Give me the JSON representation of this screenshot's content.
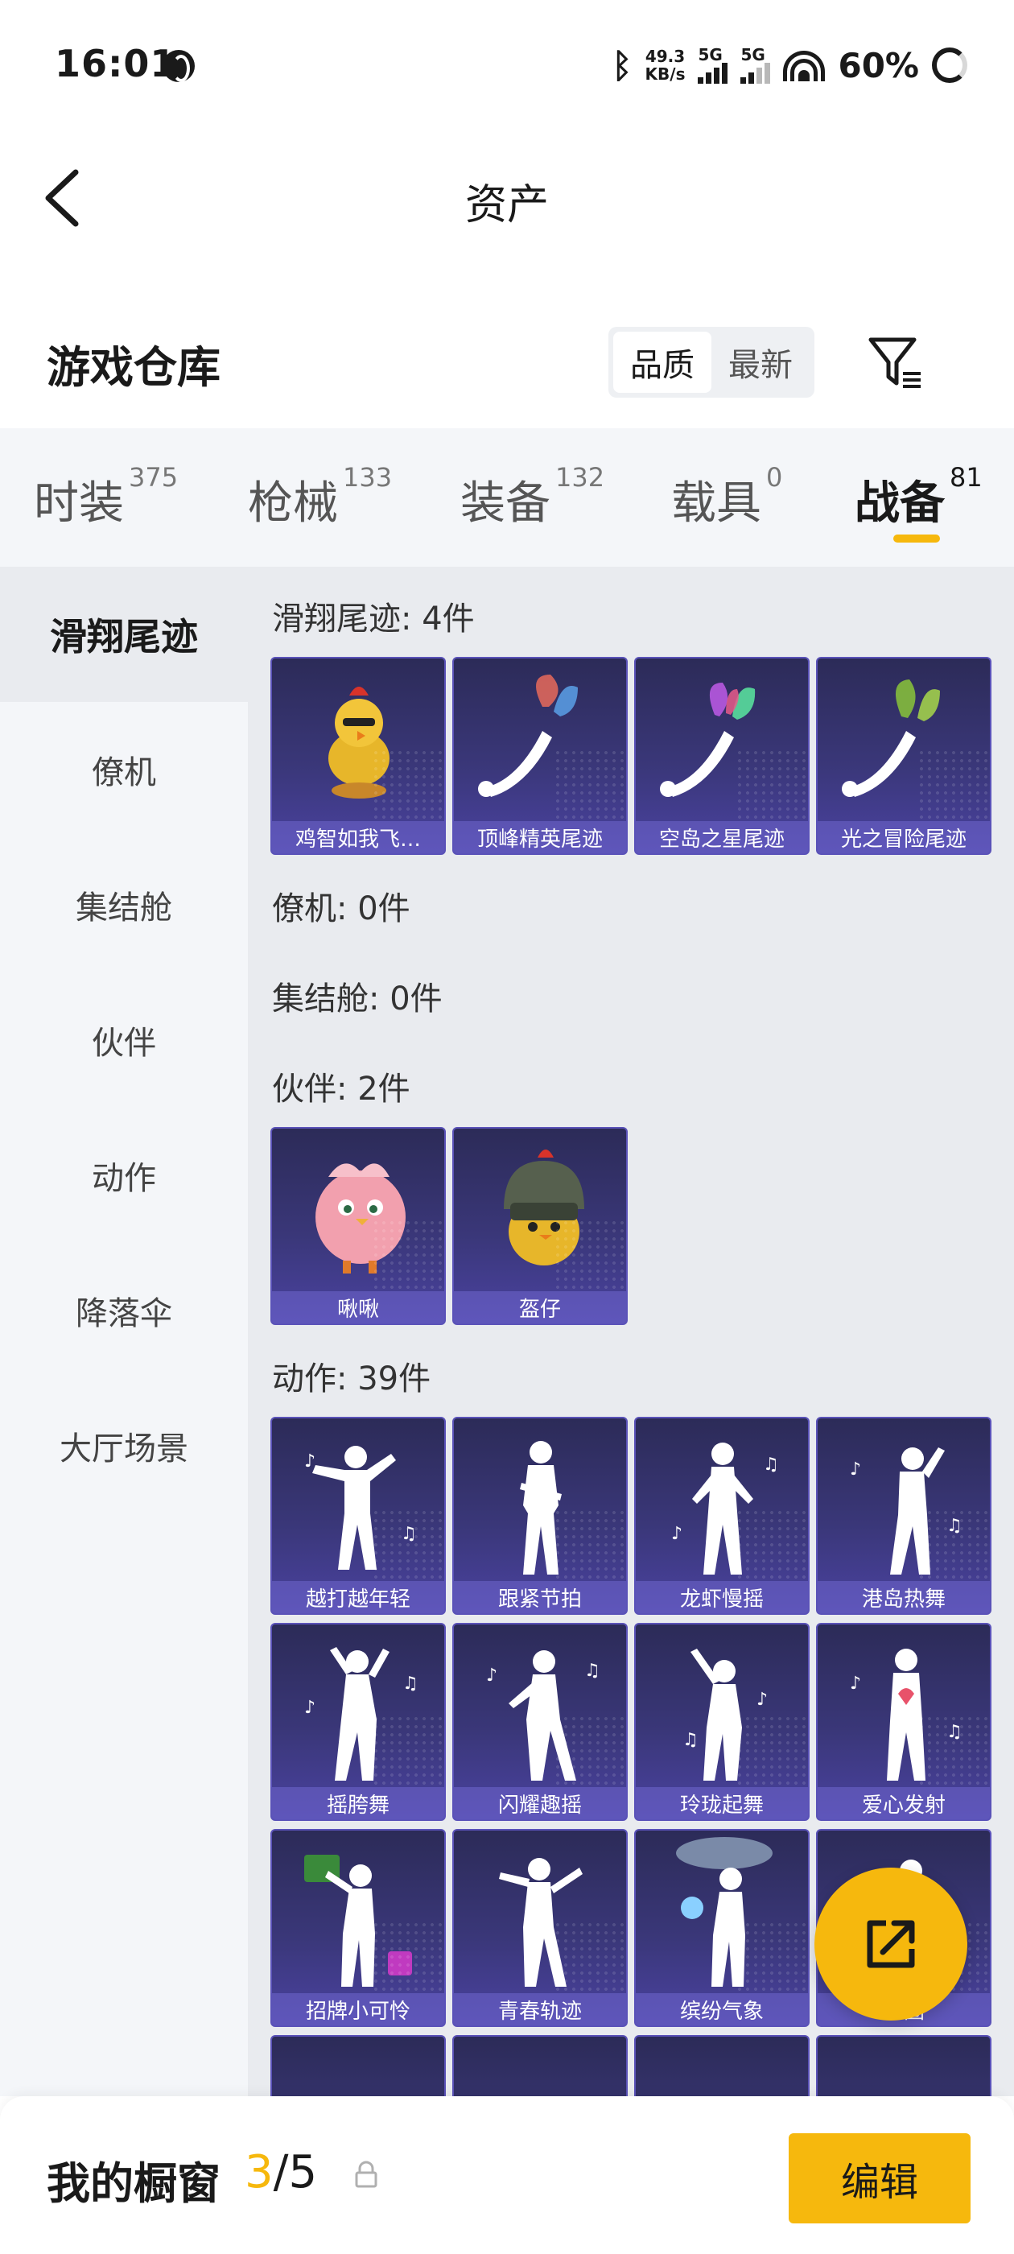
{
  "status_bar": {
    "time": "16:01",
    "net_speed_value": "49.3",
    "net_speed_unit": "KB/s",
    "sim1_label": "5G",
    "sim2_label": "5G",
    "battery": "60%"
  },
  "header": {
    "title": "资产"
  },
  "warehouse": {
    "title": "游戏仓库",
    "sort_options": [
      "品质",
      "最新"
    ],
    "active_sort": "品质"
  },
  "tabs": [
    {
      "label": "时装",
      "count": "375"
    },
    {
      "label": "枪械",
      "count": "133"
    },
    {
      "label": "装备",
      "count": "132"
    },
    {
      "label": "载具",
      "count": "0"
    },
    {
      "label": "战备",
      "count": "81"
    }
  ],
  "active_tab": "战备",
  "sidebar": {
    "items": [
      "滑翔尾迹",
      "僚机",
      "集结舱",
      "伙伴",
      "动作",
      "降落伞",
      "大厅场景"
    ],
    "active": "滑翔尾迹"
  },
  "sections": [
    {
      "title": "滑翔尾迹: 4件",
      "items": [
        "鸡智如我飞…",
        "顶峰精英尾迹",
        "空岛之星尾迹",
        "光之冒险尾迹"
      ]
    },
    {
      "title": "僚机: 0件",
      "items": []
    },
    {
      "title": "集结舱: 0件",
      "items": []
    },
    {
      "title": "伙伴: 2件",
      "items": [
        "啾啾",
        "盔仔"
      ]
    },
    {
      "title": "动作: 39件",
      "items": [
        "越打越年轻",
        "跟紧节拍",
        "龙虾慢摇",
        "港岛热舞",
        "摇胯舞",
        "闪耀趣摇",
        "玲珑起舞",
        "爱心发射",
        "招牌小可怜",
        "青春轨迹",
        "缤纷气象",
        "…圈"
      ]
    }
  ],
  "bottom_bar": {
    "label": "我的橱窗",
    "count_current": "3",
    "count_sep": "/",
    "count_total": "5",
    "edit_label": "编辑"
  },
  "colors": {
    "accent": "#f6b80d",
    "card_bg": "#3a3779"
  },
  "icons": [
    "back-arrow-icon",
    "filter-icon",
    "share-out-icon",
    "lock-icon",
    "bluetooth-icon",
    "wifi-icon",
    "globe-icon"
  ]
}
